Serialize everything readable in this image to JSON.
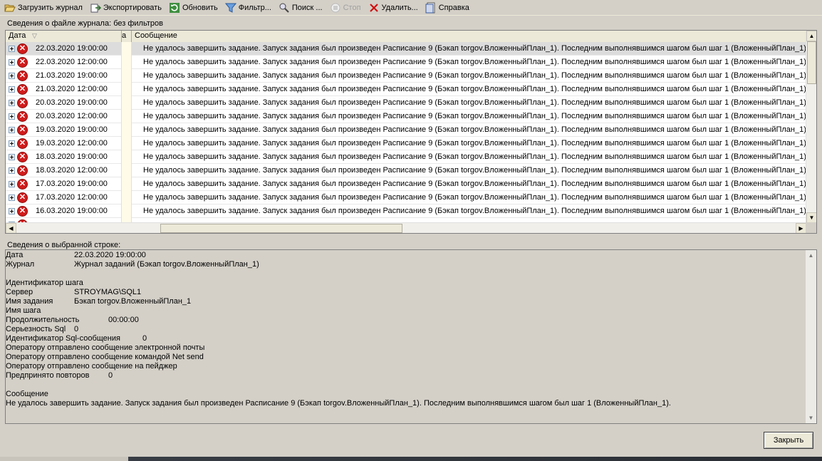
{
  "toolbar": [
    {
      "id": "load",
      "label": "Загрузить журнал",
      "icon": "folder-open-icon",
      "disabled": false
    },
    {
      "id": "export",
      "label": "Экспортировать",
      "icon": "export-icon",
      "disabled": false
    },
    {
      "id": "refresh",
      "label": "Обновить",
      "icon": "refresh-icon",
      "disabled": false
    },
    {
      "id": "filter",
      "label": "Фильтр...",
      "icon": "filter-icon",
      "disabled": false
    },
    {
      "id": "search",
      "label": "Поиск ...",
      "icon": "search-icon",
      "disabled": false
    },
    {
      "id": "stop",
      "label": "Стоп",
      "icon": "stop-icon",
      "disabled": true
    },
    {
      "id": "delete",
      "label": "Удалить...",
      "icon": "delete-icon",
      "disabled": false
    },
    {
      "id": "help",
      "label": "Справка",
      "icon": "help-icon",
      "disabled": false
    }
  ],
  "log_section_label": "Сведения о файле журнала: без фильтров",
  "grid": {
    "headers": {
      "date": "Дата",
      "e": "а",
      "message": "Сообщение"
    },
    "message": "Не удалось завершить задание.  Запуск задания был произведен Расписание 9 (Бэкап torgov.ВложенныйПлан_1). Последним выполнявшимся шагом был шаг 1 (ВложенныйПлан_1).",
    "rows": [
      "22.03.2020 19:00:00",
      "22.03.2020 12:00:00",
      "21.03.2020 19:00:00",
      "21.03.2020 12:00:00",
      "20.03.2020 19:00:00",
      "20.03.2020 12:00:00",
      "19.03.2020 19:00:00",
      "19.03.2020 12:00:00",
      "18.03.2020 19:00:00",
      "18.03.2020 12:00:00",
      "17.03.2020 19:00:00",
      "17.03.2020 12:00:00",
      "16.03.2020 19:00:00"
    ],
    "selected_row": 0
  },
  "detail_section_label": "Сведения о выбранной строке:",
  "details": [
    {
      "key": "Дата",
      "value": "22.03.2020 19:00:00"
    },
    {
      "key": "Журнал",
      "value": "Журнал заданий (Бэкап torgov.ВложенныйПлан_1)"
    },
    {
      "key": "",
      "value": ""
    },
    {
      "key": "Идентификатор шага",
      "value": ""
    },
    {
      "key": "Сервер",
      "value": "STROYMAG\\SQL1"
    },
    {
      "key": "Имя задания",
      "value": "Бэкап torgov.ВложенныйПлан_1"
    },
    {
      "key": "Имя шага",
      "value": ""
    },
    {
      "key": "Продолжительность",
      "value": "00:00:00"
    },
    {
      "key": "Серьезность Sql",
      "value": "0"
    },
    {
      "key": "Идентификатор Sql-сообщения",
      "value": "0"
    },
    {
      "key": "Оператору отправлено сообщение электронной почты",
      "value": ""
    },
    {
      "key": "Оператору отправлено сообщение командой Net send",
      "value": ""
    },
    {
      "key": "Оператору отправлено сообщение на пейджер",
      "value": ""
    },
    {
      "key": "Предпринято повторов",
      "value": "0"
    },
    {
      "key": "",
      "value": ""
    },
    {
      "key": "Сообщение",
      "value": ""
    },
    {
      "key": "Не удалось завершить задание.  Запуск задания был произведен Расписание 9 (Бэкап torgov.ВложенныйПлан_1). Последним выполнявшимся шагом был шаг 1 (ВложенныйПлан_1).",
      "value": ""
    }
  ],
  "close_label": "Закрыть",
  "colors": {
    "error": "#d11b1b",
    "selected_row": "#dcdcdc",
    "window_bg": "#d4d0c8"
  }
}
